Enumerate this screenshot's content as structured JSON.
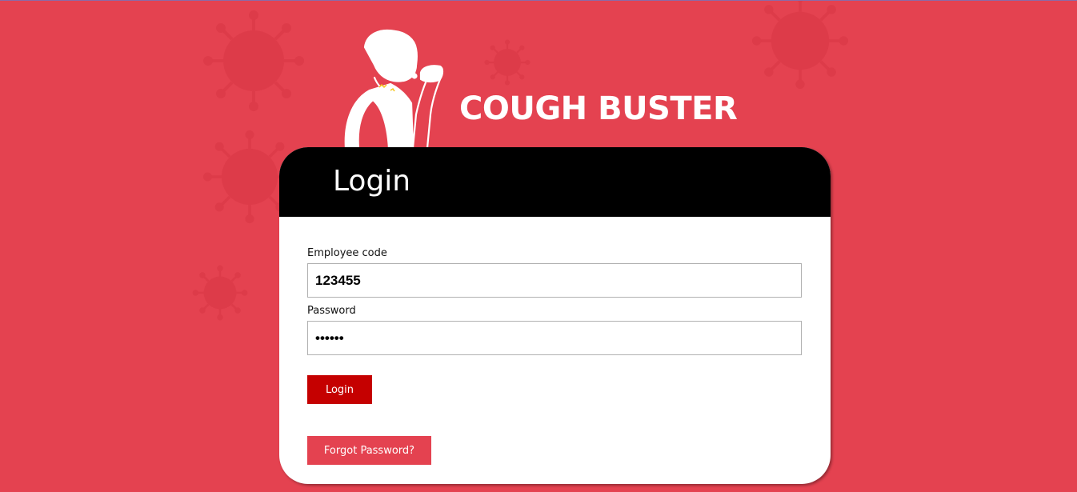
{
  "brand": {
    "name": "COUGH BUSTER"
  },
  "login_card": {
    "title": "Login",
    "employee_code": {
      "label": "Employee code",
      "value": "123455"
    },
    "password": {
      "label": "Password",
      "value": "••••••"
    },
    "login_button": "Login",
    "forgot_password_button": "Forgot Password?"
  },
  "colors": {
    "background": "#e44250",
    "header": "#000000",
    "login_button": "#c50000",
    "forgot_button": "#e44250"
  },
  "icons": {
    "logo_illustration": "coughing-man-icon",
    "background_decoration": "virus-icon"
  }
}
